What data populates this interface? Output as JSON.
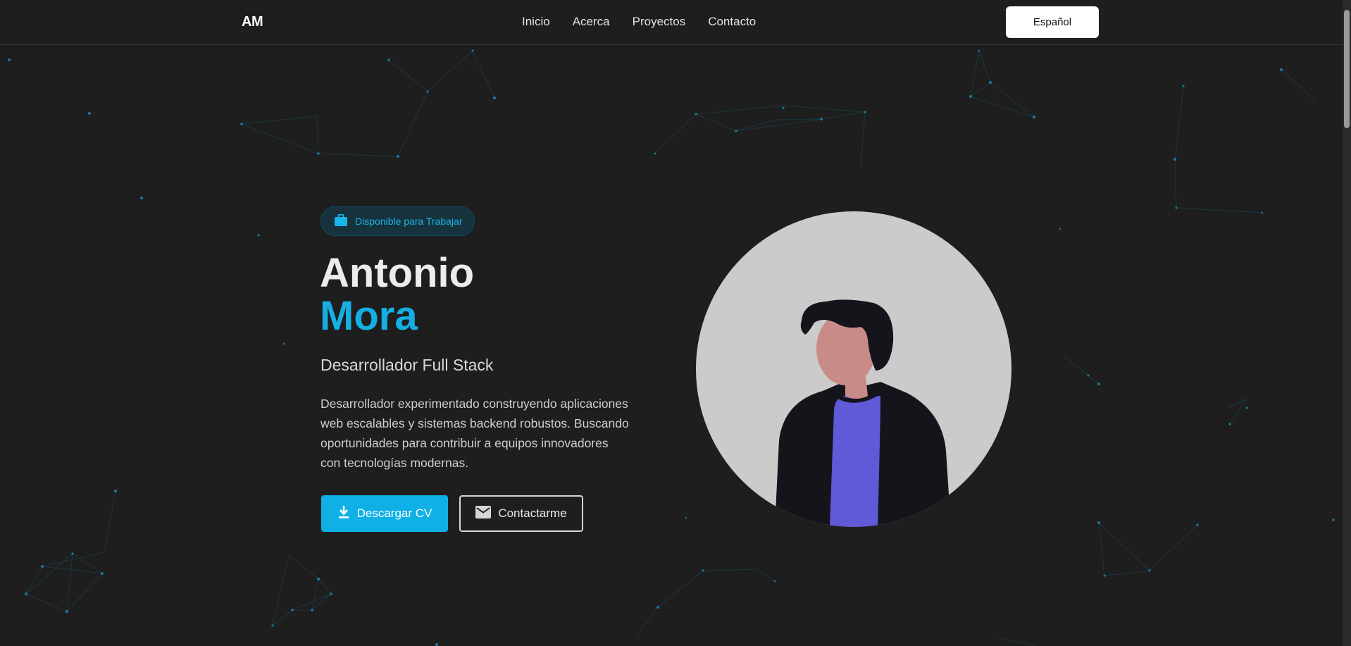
{
  "nav": {
    "logo": "AM",
    "links": [
      "Inicio",
      "Acerca",
      "Proyectos",
      "Contacto"
    ],
    "language_button": "Español"
  },
  "hero": {
    "badge": "Disponible para Trabajar",
    "first_name": "Antonio",
    "last_name": "Mora",
    "role": "Desarrollador Full Stack",
    "bio": "Desarrollador experimentado construyendo aplicaciones web escalables y sistemas backend robustos. Buscando oportunidades para contribuir a equipos innovadores con tecnologías modernas.",
    "download_cv": "Descargar CV",
    "contact_me": "Contactarme"
  },
  "icons": {
    "badge": "briefcase-icon",
    "download": "download-icon",
    "contact": "mail-icon"
  },
  "colors": {
    "background": "#1e1e1e",
    "accent": "#16aee3",
    "avatar_bg": "#cbcbcb",
    "shirt": "#6059d8"
  }
}
